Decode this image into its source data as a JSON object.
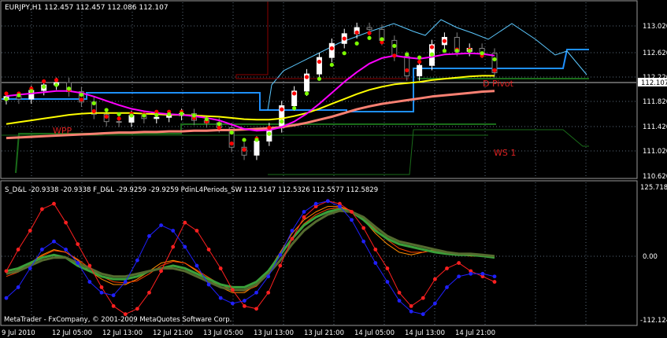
{
  "colors": {
    "background": "#000000",
    "grid": "#5a6a7a",
    "bull_candle": "#ffffff",
    "bear_candle": "#808080",
    "red_dots": "#ff0000",
    "green_dots": "#7cfc00",
    "magenta_ma": "#ff00ff",
    "yellow_ma": "#ffff00",
    "salmon_ma": "#fa8072",
    "pivot_blue": "#1e90ff",
    "pivot_cyan": "#5bc8ff",
    "darkgreen_line": "#1a6b1a",
    "stoch_red": "#ff2020",
    "stoch_blue": "#2020ff",
    "stoch_green": "#3aa03a"
  },
  "chart_data": [
    {
      "type": "candlestick",
      "title": "EURJPY,H1  112.457 112.457 112.086 112.107",
      "price_labels": [
        "113.020",
        "112.620",
        "112.220",
        "111.820",
        "111.420",
        "111.020",
        "110.620"
      ],
      "current_price": "112.107",
      "ylim": [
        110.62,
        113.26
      ],
      "annotations": [
        "D Pivot",
        "WPP",
        "WS 1"
      ],
      "series": [
        {
          "name": "close",
          "values": [
            111.91,
            111.87,
            112.01,
            112.1,
            112.14,
            111.99,
            111.82,
            111.62,
            111.5,
            111.49,
            111.6,
            111.55,
            111.57,
            111.6,
            111.63,
            111.52,
            111.48,
            111.4,
            111.08,
            110.95,
            111.18,
            111.4,
            111.76,
            112.0,
            112.28,
            112.55,
            112.78,
            112.94,
            113.04,
            113.01,
            112.83,
            112.57,
            112.25,
            112.42,
            112.76,
            112.88,
            112.65,
            112.7,
            112.62,
            112.3
          ]
        },
        {
          "name": "red_dots",
          "values": [
            111.96,
            111.96,
            112.04,
            112.16,
            112.18,
            112.02,
            111.86,
            111.67,
            111.58,
            111.55,
            111.63,
            111.62,
            111.66,
            111.66,
            111.66,
            111.56,
            111.5,
            111.4,
            111.14,
            111.04,
            111.22,
            111.4,
            111.7,
            111.96,
            112.23,
            112.48,
            112.7,
            112.86,
            112.96,
            112.95,
            112.8,
            112.58,
            112.34,
            112.48,
            112.72,
            112.82,
            112.68,
            112.68,
            112.58,
            112.34
          ]
        },
        {
          "name": "green_dots",
          "values": [
            111.87,
            111.93,
            112.0,
            112.07,
            112.1,
            112.04,
            111.94,
            111.8,
            111.69,
            111.62,
            111.6,
            111.6,
            111.61,
            111.62,
            111.63,
            111.6,
            111.54,
            111.46,
            111.32,
            111.2,
            111.2,
            111.3,
            111.5,
            111.72,
            111.96,
            112.2,
            112.43,
            112.62,
            112.78,
            112.87,
            112.85,
            112.74,
            112.6,
            112.55,
            112.6,
            112.66,
            112.66,
            112.66,
            112.62,
            112.52
          ]
        },
        {
          "name": "magenta_ma",
          "values": [
            111.92,
            111.94,
            111.96,
            111.98,
            112.0,
            112.0,
            111.97,
            111.91,
            111.84,
            111.77,
            111.71,
            111.67,
            111.64,
            111.62,
            111.61,
            111.59,
            111.56,
            111.52,
            111.45,
            111.38,
            111.35,
            111.36,
            111.41,
            111.5,
            111.63,
            111.79,
            111.97,
            112.15,
            112.31,
            112.45,
            112.54,
            112.58,
            112.55,
            112.53,
            112.56,
            112.6,
            112.61,
            112.62,
            112.61,
            112.58
          ]
        },
        {
          "name": "yellow_ma",
          "values": [
            111.46,
            111.49,
            111.52,
            111.55,
            111.58,
            111.61,
            111.63,
            111.64,
            111.64,
            111.64,
            111.64,
            111.63,
            111.62,
            111.61,
            111.61,
            111.6,
            111.59,
            111.58,
            111.56,
            111.54,
            111.53,
            111.53,
            111.55,
            111.59,
            111.64,
            111.71,
            111.79,
            111.87,
            111.95,
            112.02,
            112.07,
            112.11,
            112.13,
            112.15,
            112.18,
            112.2,
            112.22,
            112.24,
            112.25,
            112.25
          ]
        },
        {
          "name": "salmon_ma",
          "values": [
            111.23,
            111.24,
            111.25,
            111.26,
            111.27,
            111.28,
            111.29,
            111.3,
            111.31,
            111.32,
            111.32,
            111.33,
            111.33,
            111.34,
            111.34,
            111.35,
            111.35,
            111.36,
            111.36,
            111.37,
            111.38,
            111.39,
            111.41,
            111.44,
            111.48,
            111.53,
            111.58,
            111.64,
            111.7,
            111.75,
            111.79,
            111.82,
            111.85,
            111.88,
            111.91,
            111.93,
            111.95,
            111.97,
            111.99,
            112.0
          ]
        }
      ]
    },
    {
      "type": "line",
      "title": "S_D&L -20.9338 -20.9338   F_D&L -29.9259 -29.9259   PdinL4Periods_SW 112.5147 112.5326 112.5577 112.5829",
      "axis_labels": [
        "125.718",
        "0.00",
        "-112.124"
      ],
      "ylim": [
        -112.124,
        125.718
      ],
      "series": [
        {
          "name": "red",
          "values": [
            -20,
            20,
            55,
            95,
            105,
            70,
            30,
            -10,
            -50,
            -85,
            -100,
            -90,
            -60,
            -20,
            25,
            70,
            55,
            20,
            -15,
            -55,
            -85,
            -90,
            -60,
            -10,
            40,
            80,
            100,
            110,
            105,
            90,
            60,
            20,
            -15,
            -60,
            -85,
            -70,
            -35,
            -15,
            -5,
            -20,
            -30,
            -40
          ]
        },
        {
          "name": "blue",
          "values": [
            -70,
            -50,
            -15,
            20,
            35,
            20,
            -5,
            -40,
            -60,
            -65,
            -40,
            0,
            45,
            65,
            55,
            25,
            -10,
            -45,
            -70,
            -80,
            -75,
            -60,
            -30,
            10,
            55,
            90,
            105,
            110,
            100,
            75,
            35,
            -5,
            -40,
            -75,
            -95,
            -100,
            -80,
            -50,
            -30,
            -25,
            -25,
            -30
          ]
        },
        {
          "name": "green_1",
          "values": [
            -20,
            -15,
            -5,
            5,
            10,
            5,
            -10,
            -20,
            -30,
            -35,
            -35,
            -30,
            -20,
            -15,
            -10,
            -15,
            -25,
            -35,
            -45,
            -50,
            -50,
            -40,
            -20,
            10,
            40,
            65,
            80,
            90,
            95,
            90,
            75,
            55,
            40,
            30,
            25,
            20,
            15,
            12,
            10,
            10,
            8,
            5
          ]
        },
        {
          "name": "green_2",
          "values": [
            -25,
            -20,
            -10,
            0,
            5,
            5,
            -5,
            -15,
            -25,
            -30,
            -30,
            -25,
            -20,
            -15,
            -15,
            -20,
            -30,
            -40,
            -50,
            -55,
            -55,
            -45,
            -25,
            0,
            30,
            55,
            72,
            85,
            92,
            90,
            80,
            62,
            45,
            35,
            30,
            25,
            20,
            15,
            12,
            12,
            10,
            8
          ]
        },
        {
          "name": "orange_1",
          "values": [
            -25,
            -18,
            -5,
            10,
            20,
            15,
            0,
            -20,
            -35,
            -45,
            -45,
            -35,
            -20,
            -5,
            0,
            -5,
            -20,
            -35,
            -50,
            -60,
            -60,
            -45,
            -20,
            15,
            50,
            75,
            90,
            100,
            100,
            92,
            75,
            50,
            30,
            15,
            10,
            15,
            20,
            15,
            10,
            8,
            8,
            5
          ]
        },
        {
          "name": "orange_2",
          "values": [
            -30,
            -22,
            -8,
            8,
            18,
            15,
            2,
            -15,
            -30,
            -40,
            -42,
            -38,
            -25,
            -10,
            -2,
            -5,
            -18,
            -32,
            -45,
            -55,
            -57,
            -48,
            -25,
            8,
            42,
            68,
            85,
            95,
            98,
            92,
            78,
            58,
            38,
            22,
            15,
            15,
            18,
            15,
            12,
            10,
            8,
            6
          ]
        }
      ]
    }
  ],
  "xaxis": {
    "labels": [
      "9 Jul 2010",
      "12 Jul 05:00",
      "12 Jul 13:00",
      "12 Jul 21:00",
      "13 Jul 05:00",
      "13 Jul 13:00",
      "13 Jul 21:00",
      "14 Jul 05:00",
      "14 Jul 13:00",
      "14 Jul 21:00"
    ]
  },
  "copyright": "MetaTrader - FxCompany, © 2001-2009 MetaQuotes Software Corp."
}
